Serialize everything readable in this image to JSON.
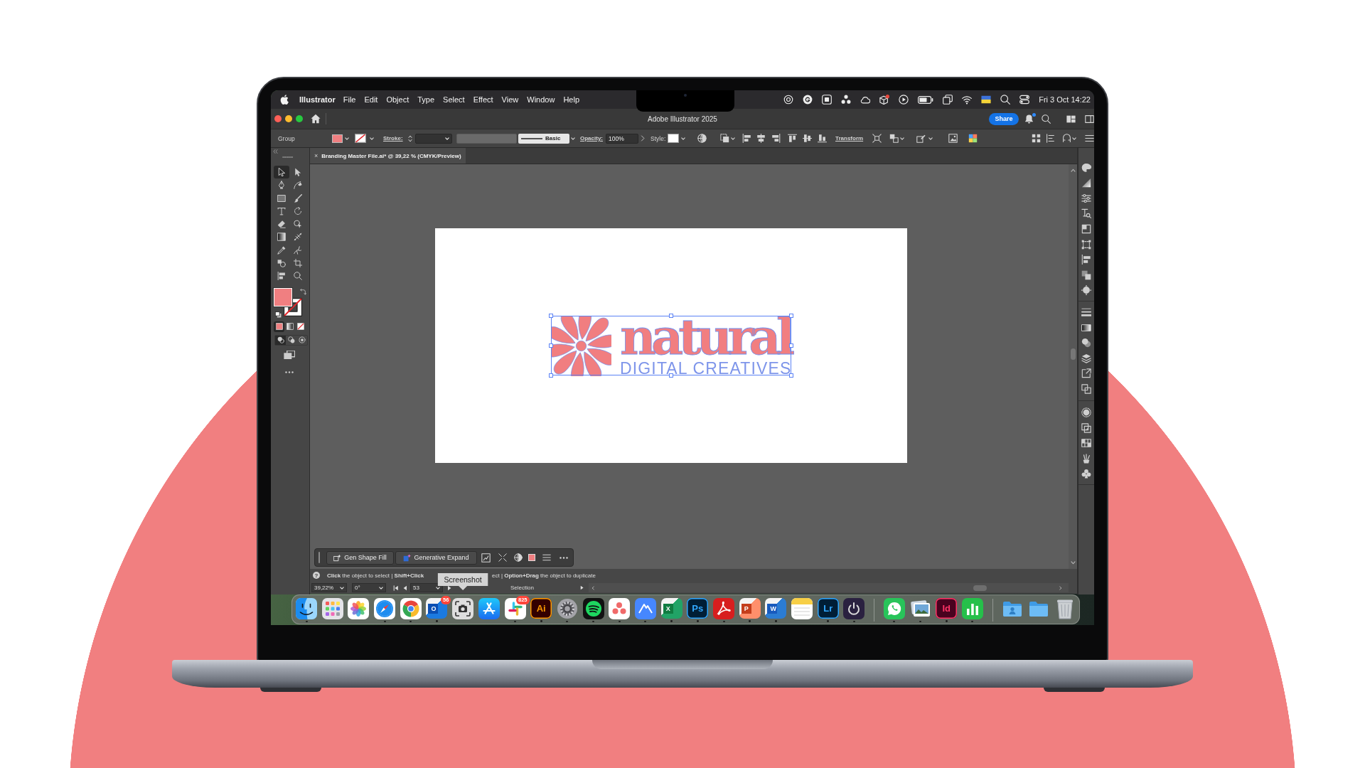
{
  "menubar": {
    "app_name": "Illustrator",
    "menus": [
      "File",
      "Edit",
      "Object",
      "Type",
      "Select",
      "Effect",
      "View",
      "Window",
      "Help"
    ],
    "clock": "Fri 3 Oct 14:22"
  },
  "window": {
    "title": "Adobe Illustrator 2025",
    "share_button": "Share",
    "notification": true
  },
  "control_bar": {
    "selection_type": "Group",
    "stroke_label": "Stroke:",
    "stroke_profile": "Basic",
    "opacity_label": "Opacity:",
    "opacity": "100%",
    "style_label": "Style:",
    "transform_link": "Transform"
  },
  "toolbar": {
    "tools": [
      {
        "kind": "selection",
        "selected": true
      },
      {
        "kind": "direct",
        "selected": false
      },
      {
        "kind": "pen",
        "selected": false
      },
      {
        "kind": "curvature",
        "selected": false
      },
      {
        "kind": "rectangle",
        "selected": false
      },
      {
        "kind": "brush",
        "selected": false
      },
      {
        "kind": "type",
        "selected": false
      },
      {
        "kind": "rotate",
        "selected": false
      },
      {
        "kind": "eraser",
        "selected": false
      },
      {
        "kind": "shapebuilder",
        "selected": false
      },
      {
        "kind": "gradient",
        "selected": false
      },
      {
        "kind": "width",
        "selected": false
      },
      {
        "kind": "eyedropper",
        "selected": false
      },
      {
        "kind": "puppet",
        "selected": false
      },
      {
        "kind": "blend",
        "selected": false
      },
      {
        "kind": "artboard",
        "selected": false
      },
      {
        "kind": "align",
        "selected": false
      },
      {
        "kind": "zoom",
        "selected": false
      }
    ],
    "color_modes": [
      {
        "kind": "color",
        "selected": true
      },
      {
        "kind": "gradient",
        "selected": false
      },
      {
        "kind": "none",
        "selected": false
      }
    ],
    "draw_modes": [
      {
        "kind": "normal",
        "selected": true
      },
      {
        "kind": "behind",
        "selected": false
      },
      {
        "kind": "inside",
        "selected": false
      }
    ]
  },
  "document_tab": {
    "close": "×",
    "title": "Branding Master File.ai* @ 39,22 % (CMYK/Preview)",
    "selected": true
  },
  "artwork": {
    "wordmark": "natural",
    "tagline": "DIGITAL CREATIVES",
    "selected": true
  },
  "task_bar": {
    "buttons": [
      {
        "kind": "shape-fill",
        "label": "Gen Shape Fill"
      },
      {
        "kind": "expand",
        "label": "Generative Expand"
      }
    ]
  },
  "status_bar": {
    "help": "?",
    "hint": [
      "**Click** the object to select | **Shift+Click**",
      "ect | **Option+Drag** the object to duplicate"
    ],
    "zoom": "39,22%",
    "rotation": "0°",
    "artboard": "53",
    "tool": "Selection"
  },
  "dock": {
    "apps": [
      {
        "kind": "finder",
        "running": true
      },
      {
        "kind": "launchpad",
        "running": false
      },
      {
        "kind": "photos",
        "running": false
      },
      {
        "kind": "safari",
        "running": true
      },
      {
        "kind": "chrome",
        "running": true
      },
      {
        "kind": "outlook",
        "letters": "O",
        "badge": "56",
        "running": true
      },
      {
        "kind": "screenshot",
        "tooltip": "Screenshot",
        "running": false
      },
      {
        "kind": "appstore",
        "running": false
      },
      {
        "kind": "slack",
        "badge": "825",
        "running": true
      },
      {
        "kind": "illustrator",
        "letters": "Ai",
        "running": true
      },
      {
        "kind": "settings",
        "running": true
      },
      {
        "kind": "spotify",
        "running": true
      },
      {
        "kind": "asana",
        "running": true
      },
      {
        "kind": "nordvpn",
        "running": true
      },
      {
        "kind": "excel",
        "letters": "X",
        "running": true
      },
      {
        "kind": "photoshop",
        "letters": "Ps",
        "running": true
      },
      {
        "kind": "acrobat",
        "running": true
      },
      {
        "kind": "powerpoint",
        "letters": "P",
        "running": true
      },
      {
        "kind": "word",
        "letters": "W",
        "running": true
      },
      {
        "kind": "notes",
        "running": false
      },
      {
        "kind": "lightroom",
        "letters": "Lr",
        "running": true
      },
      {
        "kind": "timer",
        "running": true
      }
    ],
    "recent": [
      {
        "kind": "whatsapp",
        "running": true
      },
      {
        "kind": "preview",
        "running": true
      },
      {
        "kind": "indesign",
        "letters": "Id",
        "running": true
      },
      {
        "kind": "numbers",
        "running": true
      }
    ],
    "stack": [
      {
        "kind": "userfolder",
        "running": false
      },
      {
        "kind": "folder",
        "running": false
      },
      {
        "kind": "trash",
        "running": false
      }
    ]
  }
}
